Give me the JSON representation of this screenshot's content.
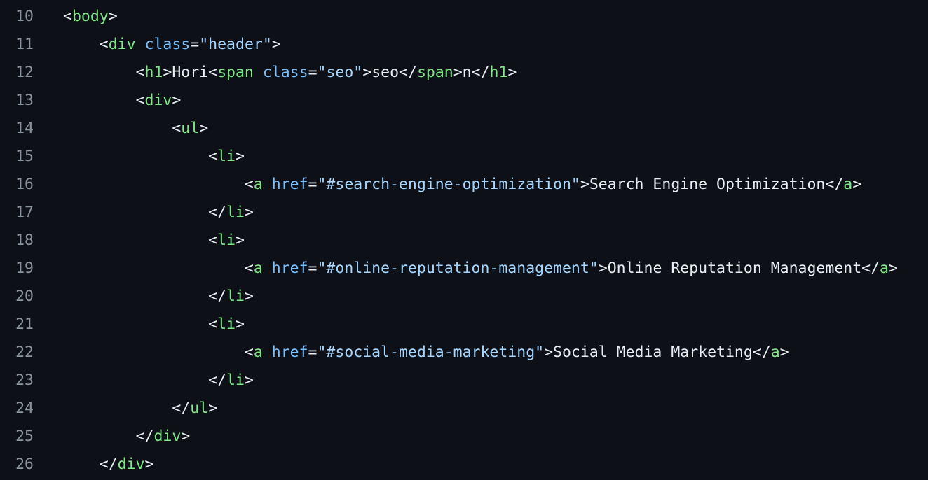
{
  "colors": {
    "background": "#0d1117",
    "line_number": "#8b949e",
    "punctuation": "#e6edf3",
    "tag": "#7ee787",
    "attribute": "#79c0ff",
    "string": "#a5d6ff",
    "text": "#e6edf3"
  },
  "lines": [
    {
      "num": "10",
      "tokens": [
        {
          "t": "punct",
          "v": "<"
        },
        {
          "t": "tag",
          "v": "body"
        },
        {
          "t": "punct",
          "v": ">"
        }
      ]
    },
    {
      "num": "11",
      "tokens": [
        {
          "t": "text",
          "v": "    "
        },
        {
          "t": "punct",
          "v": "<"
        },
        {
          "t": "tag",
          "v": "div"
        },
        {
          "t": "text",
          "v": " "
        },
        {
          "t": "attr",
          "v": "class"
        },
        {
          "t": "punct",
          "v": "="
        },
        {
          "t": "str",
          "v": "\"header\""
        },
        {
          "t": "punct",
          "v": ">"
        }
      ]
    },
    {
      "num": "12",
      "tokens": [
        {
          "t": "text",
          "v": "        "
        },
        {
          "t": "punct",
          "v": "<"
        },
        {
          "t": "tag",
          "v": "h1"
        },
        {
          "t": "punct",
          "v": ">"
        },
        {
          "t": "text",
          "v": "Hori"
        },
        {
          "t": "punct",
          "v": "<"
        },
        {
          "t": "tag",
          "v": "span"
        },
        {
          "t": "text",
          "v": " "
        },
        {
          "t": "attr",
          "v": "class"
        },
        {
          "t": "punct",
          "v": "="
        },
        {
          "t": "str",
          "v": "\"seo\""
        },
        {
          "t": "punct",
          "v": ">"
        },
        {
          "t": "text",
          "v": "seo"
        },
        {
          "t": "punct",
          "v": "</"
        },
        {
          "t": "tag",
          "v": "span"
        },
        {
          "t": "punct",
          "v": ">"
        },
        {
          "t": "text",
          "v": "n"
        },
        {
          "t": "punct",
          "v": "</"
        },
        {
          "t": "tag",
          "v": "h1"
        },
        {
          "t": "punct",
          "v": ">"
        }
      ]
    },
    {
      "num": "13",
      "tokens": [
        {
          "t": "text",
          "v": "        "
        },
        {
          "t": "punct",
          "v": "<"
        },
        {
          "t": "tag",
          "v": "div"
        },
        {
          "t": "punct",
          "v": ">"
        }
      ]
    },
    {
      "num": "14",
      "tokens": [
        {
          "t": "text",
          "v": "            "
        },
        {
          "t": "punct",
          "v": "<"
        },
        {
          "t": "tag",
          "v": "ul"
        },
        {
          "t": "punct",
          "v": ">"
        }
      ]
    },
    {
      "num": "15",
      "tokens": [
        {
          "t": "text",
          "v": "                "
        },
        {
          "t": "punct",
          "v": "<"
        },
        {
          "t": "tag",
          "v": "li"
        },
        {
          "t": "punct",
          "v": ">"
        }
      ]
    },
    {
      "num": "16",
      "tokens": [
        {
          "t": "text",
          "v": "                    "
        },
        {
          "t": "punct",
          "v": "<"
        },
        {
          "t": "tag",
          "v": "a"
        },
        {
          "t": "text",
          "v": " "
        },
        {
          "t": "attr",
          "v": "href"
        },
        {
          "t": "punct",
          "v": "="
        },
        {
          "t": "str",
          "v": "\"#search-engine-optimization\""
        },
        {
          "t": "punct",
          "v": ">"
        },
        {
          "t": "text",
          "v": "Search Engine Optimization"
        },
        {
          "t": "punct",
          "v": "</"
        },
        {
          "t": "tag",
          "v": "a"
        },
        {
          "t": "punct",
          "v": ">"
        }
      ]
    },
    {
      "num": "17",
      "tokens": [
        {
          "t": "text",
          "v": "                "
        },
        {
          "t": "punct",
          "v": "</"
        },
        {
          "t": "tag",
          "v": "li"
        },
        {
          "t": "punct",
          "v": ">"
        }
      ]
    },
    {
      "num": "18",
      "tokens": [
        {
          "t": "text",
          "v": "                "
        },
        {
          "t": "punct",
          "v": "<"
        },
        {
          "t": "tag",
          "v": "li"
        },
        {
          "t": "punct",
          "v": ">"
        }
      ]
    },
    {
      "num": "19",
      "tokens": [
        {
          "t": "text",
          "v": "                    "
        },
        {
          "t": "punct",
          "v": "<"
        },
        {
          "t": "tag",
          "v": "a"
        },
        {
          "t": "text",
          "v": " "
        },
        {
          "t": "attr",
          "v": "href"
        },
        {
          "t": "punct",
          "v": "="
        },
        {
          "t": "str",
          "v": "\"#online-reputation-management\""
        },
        {
          "t": "punct",
          "v": ">"
        },
        {
          "t": "text",
          "v": "Online Reputation Management"
        },
        {
          "t": "punct",
          "v": "</"
        },
        {
          "t": "tag",
          "v": "a"
        },
        {
          "t": "punct",
          "v": ">"
        }
      ]
    },
    {
      "num": "20",
      "tokens": [
        {
          "t": "text",
          "v": "                "
        },
        {
          "t": "punct",
          "v": "</"
        },
        {
          "t": "tag",
          "v": "li"
        },
        {
          "t": "punct",
          "v": ">"
        }
      ]
    },
    {
      "num": "21",
      "tokens": [
        {
          "t": "text",
          "v": "                "
        },
        {
          "t": "punct",
          "v": "<"
        },
        {
          "t": "tag",
          "v": "li"
        },
        {
          "t": "punct",
          "v": ">"
        }
      ]
    },
    {
      "num": "22",
      "tokens": [
        {
          "t": "text",
          "v": "                    "
        },
        {
          "t": "punct",
          "v": "<"
        },
        {
          "t": "tag",
          "v": "a"
        },
        {
          "t": "text",
          "v": " "
        },
        {
          "t": "attr",
          "v": "href"
        },
        {
          "t": "punct",
          "v": "="
        },
        {
          "t": "str",
          "v": "\"#social-media-marketing\""
        },
        {
          "t": "punct",
          "v": ">"
        },
        {
          "t": "text",
          "v": "Social Media Marketing"
        },
        {
          "t": "punct",
          "v": "</"
        },
        {
          "t": "tag",
          "v": "a"
        },
        {
          "t": "punct",
          "v": ">"
        }
      ]
    },
    {
      "num": "23",
      "tokens": [
        {
          "t": "text",
          "v": "                "
        },
        {
          "t": "punct",
          "v": "</"
        },
        {
          "t": "tag",
          "v": "li"
        },
        {
          "t": "punct",
          "v": ">"
        }
      ]
    },
    {
      "num": "24",
      "tokens": [
        {
          "t": "text",
          "v": "            "
        },
        {
          "t": "punct",
          "v": "</"
        },
        {
          "t": "tag",
          "v": "ul"
        },
        {
          "t": "punct",
          "v": ">"
        }
      ]
    },
    {
      "num": "25",
      "tokens": [
        {
          "t": "text",
          "v": "        "
        },
        {
          "t": "punct",
          "v": "</"
        },
        {
          "t": "tag",
          "v": "div"
        },
        {
          "t": "punct",
          "v": ">"
        }
      ]
    },
    {
      "num": "26",
      "tokens": [
        {
          "t": "text",
          "v": "    "
        },
        {
          "t": "punct",
          "v": "</"
        },
        {
          "t": "tag",
          "v": "div"
        },
        {
          "t": "punct",
          "v": ">"
        }
      ]
    }
  ]
}
